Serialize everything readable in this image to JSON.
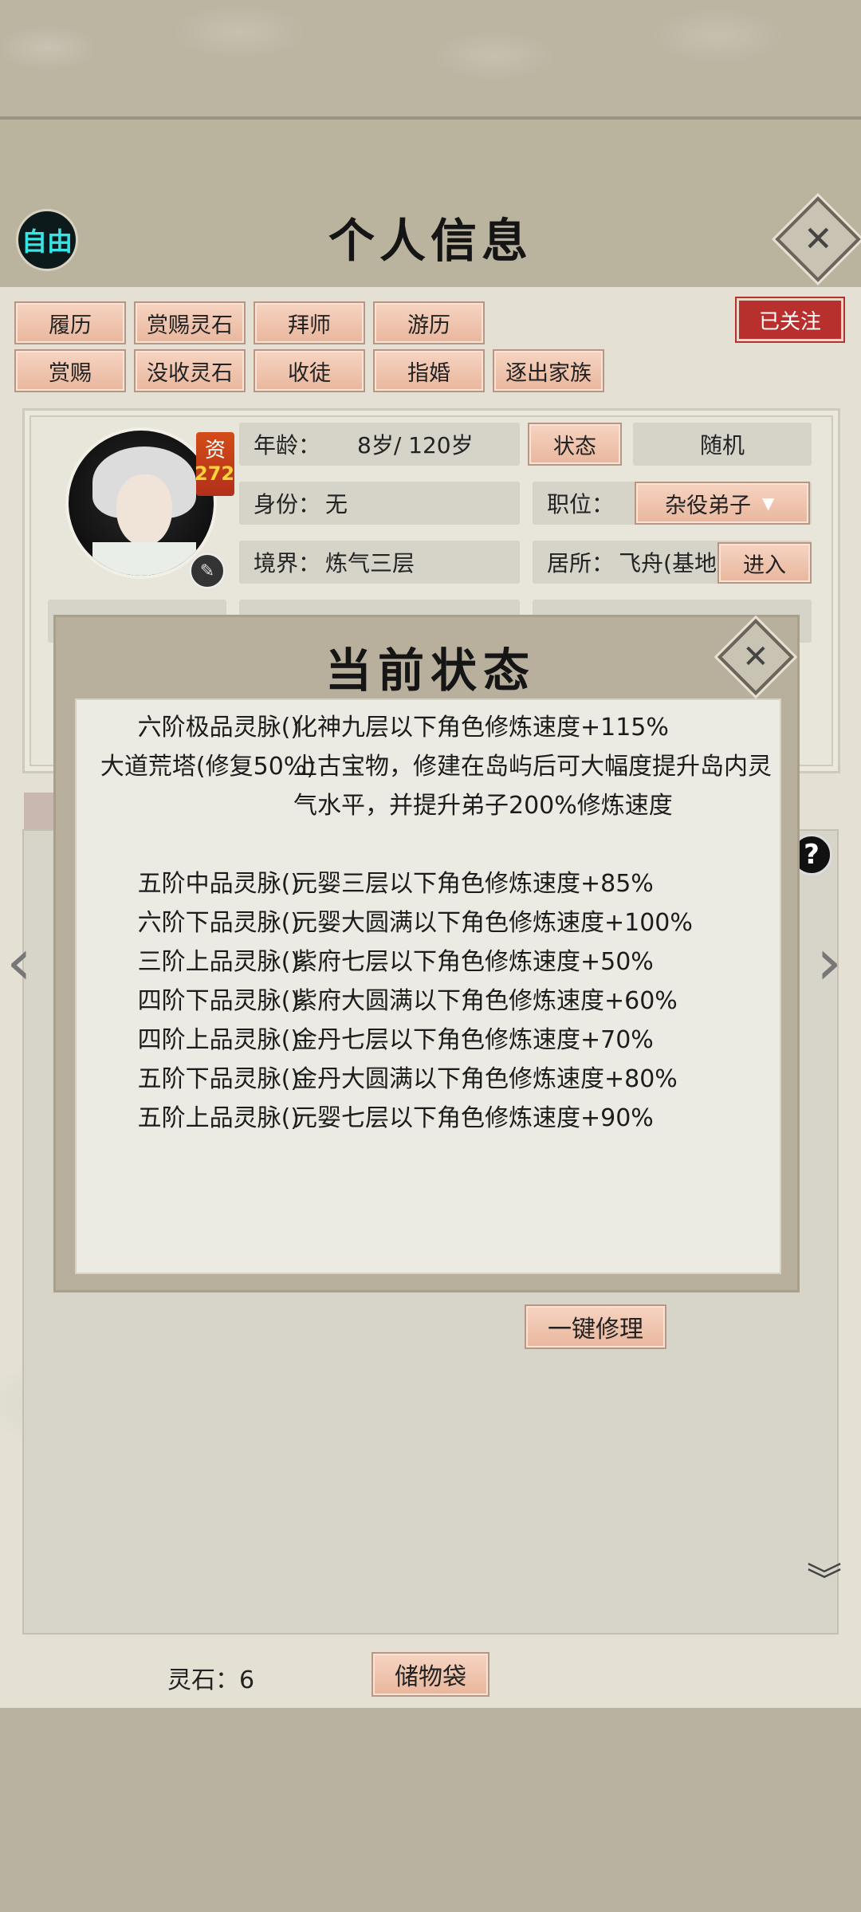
{
  "header": {
    "mode_badge": "自由",
    "title": "个人信息",
    "close_icon": "close-icon"
  },
  "actions": {
    "row1": [
      "履历",
      "赏赐灵石",
      "拜师",
      "游历"
    ],
    "row2": [
      "赏赐",
      "没收灵石",
      "收徒",
      "指婚",
      "逐出家族"
    ],
    "follow": "已关注"
  },
  "profile": {
    "aptitude_label": "资",
    "aptitude_value": "272",
    "age_label": "年龄：",
    "age_value": "8岁/ 120岁",
    "status_button": "状态",
    "random_button": "随机",
    "identity_label": "身份：",
    "identity_value": "无",
    "position_label": "职位：",
    "position_value": "杂役弟子",
    "realm_label": "境界：",
    "realm_value": "炼气三层",
    "residence_label": "居所：",
    "residence_value": "飞舟(基地",
    "enter_button": "进入"
  },
  "status_dialog": {
    "title": "当前状态",
    "rows": [
      {
        "name": "六阶极品灵脉()",
        "effect": "化神九层以下角色修炼速度+115%"
      },
      {
        "name": "大道荒塔(修复50%)",
        "effect": "上古宝物，修建在岛屿后可大幅度提升岛内灵气水平，并提升弟子200%修炼速度"
      },
      {
        "name": "五阶中品灵脉()",
        "effect": "元婴三层以下角色修炼速度+85%"
      },
      {
        "name": "六阶下品灵脉()",
        "effect": "元婴大圆满以下角色修炼速度+100%"
      },
      {
        "name": "三阶上品灵脉()",
        "effect": "紫府七层以下角色修炼速度+50%"
      },
      {
        "name": "四阶下品灵脉()",
        "effect": "紫府大圆满以下角色修炼速度+60%"
      },
      {
        "name": "四阶上品灵脉()",
        "effect": "金丹七层以下角色修炼速度+70%"
      },
      {
        "name": "五阶下品灵脉()",
        "effect": "金丹大圆满以下角色修炼速度+80%"
      },
      {
        "name": "五阶上品灵脉()",
        "effect": "元婴七层以下角色修炼速度+90%"
      }
    ]
  },
  "lower": {
    "repair_button": "一键修理",
    "help": "?"
  },
  "footer": {
    "stone_label": "灵石：6",
    "storage_button": "储物袋"
  }
}
